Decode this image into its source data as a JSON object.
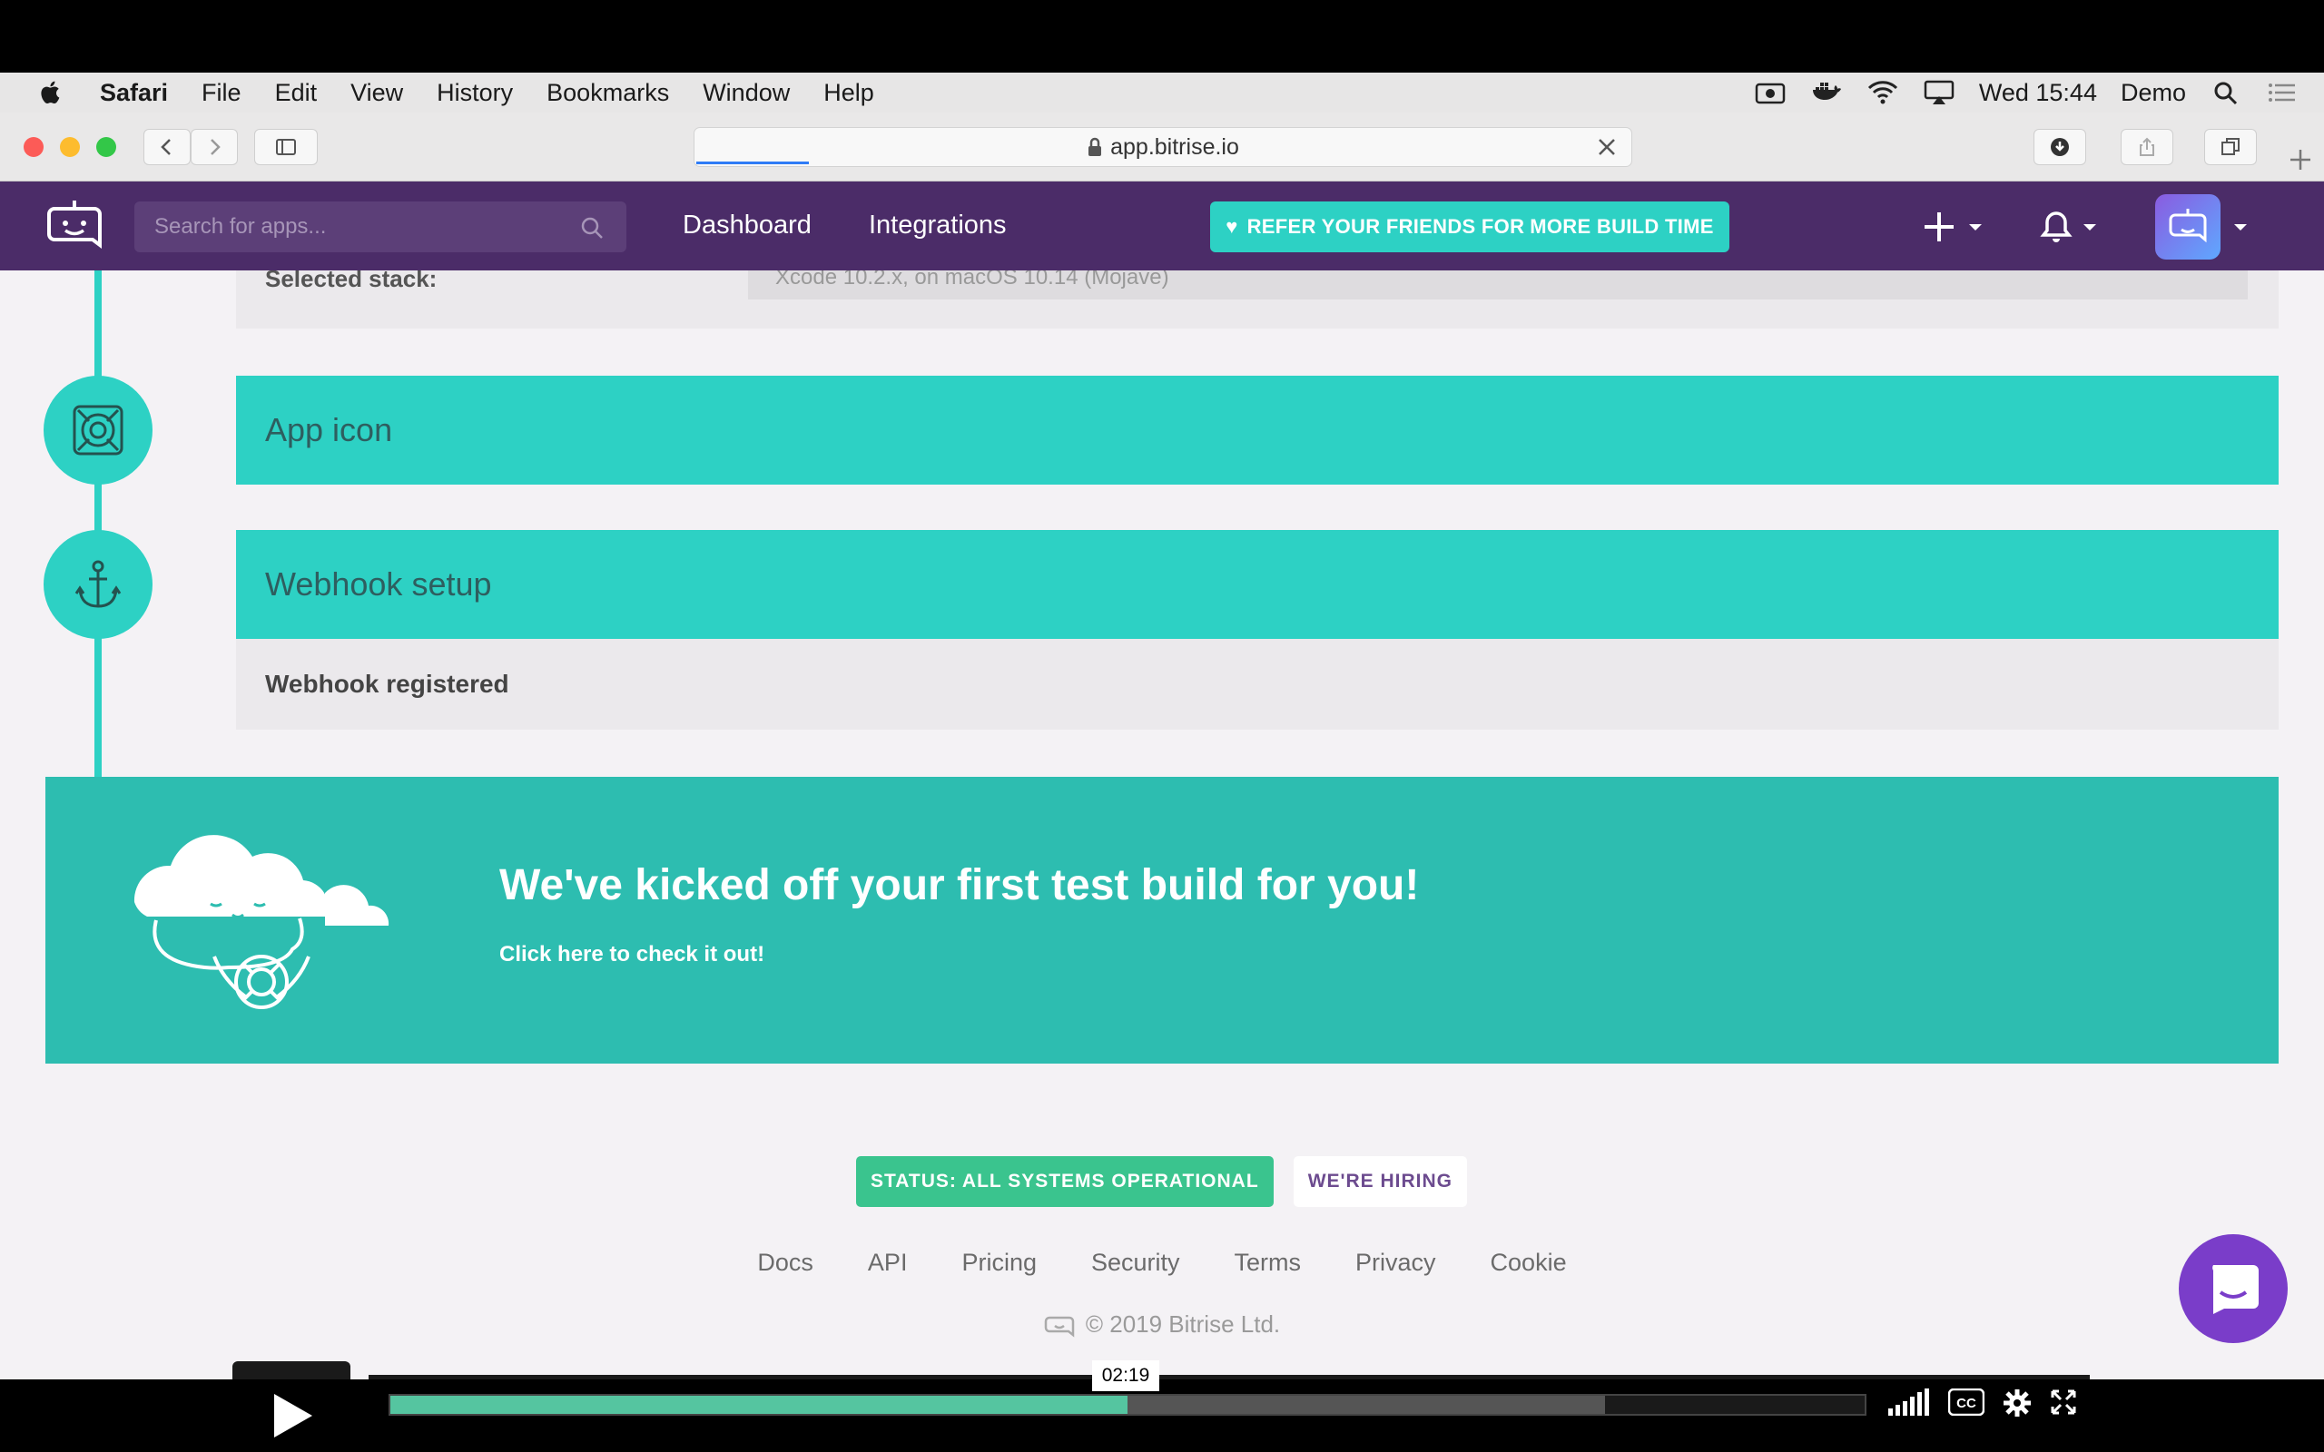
{
  "menubar": {
    "app": "Safari",
    "items": [
      "File",
      "Edit",
      "View",
      "History",
      "Bookmarks",
      "Window",
      "Help"
    ],
    "clock": "Wed 15:44",
    "user": "Demo"
  },
  "browser": {
    "url": "app.bitrise.io",
    "page_load_progress": 0.12
  },
  "nav": {
    "search_placeholder": "Search for apps...",
    "links": [
      "Dashboard",
      "Integrations"
    ],
    "referral": {
      "text": "REFER YOUR FRIENDS FOR",
      "emphasis": "MORE BUILD TIME"
    }
  },
  "content": {
    "stack": {
      "label": "Selected stack:",
      "value": "Xcode 10.2.x, on macOS 10.14 (Mojave)"
    },
    "steps": [
      {
        "title": "App icon",
        "icon": "app-icon-icon"
      },
      {
        "title": "Webhook setup",
        "icon": "anchor-icon",
        "body": "Webhook registered"
      }
    ],
    "banner": {
      "title": "We've kicked off your first test build for you!",
      "subtitle": "Click here to check it out!"
    }
  },
  "footer": {
    "status": "STATUS: ALL SYSTEMS OPERATIONAL",
    "hiring": "WE'RE HIRING",
    "links": [
      "Docs",
      "API",
      "Pricing",
      "Security",
      "Terms",
      "Privacy",
      "Cookie"
    ],
    "copyright": "© 2019 Bitrise Ltd."
  },
  "video": {
    "time": "02:19",
    "played_fraction": 0.5,
    "buffered_fraction": 0.824
  },
  "colors": {
    "brand_purple": "#4b2c68",
    "accent_teal": "#2dd1c4",
    "banner_teal": "#2dbdb0",
    "status_green": "#3ac48e"
  }
}
